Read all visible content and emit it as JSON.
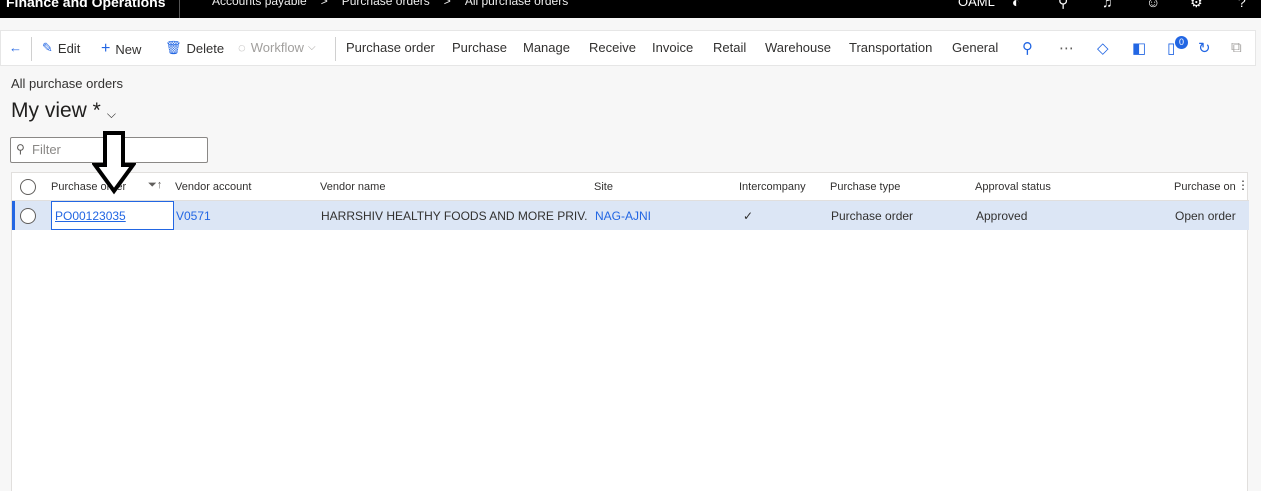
{
  "topbar": {
    "app_title": "Finance and Operations",
    "breadcrumb": [
      "Accounts payable",
      "Purchase orders",
      "All purchase orders"
    ],
    "breadcrumb_sep": ">",
    "company": "OAML"
  },
  "actionpane": {
    "edit": "Edit",
    "new": "New",
    "delete": "Delete",
    "workflow": "Workflow",
    "tabs": [
      "Purchase order",
      "Purchase",
      "Manage",
      "Receive",
      "Invoice",
      "Retail",
      "Warehouse",
      "Transportation",
      "General"
    ],
    "notification_count": "0"
  },
  "page": {
    "caption": "All purchase orders",
    "view_title": "My view *",
    "filter_placeholder": "Filter"
  },
  "grid": {
    "columns": [
      "Purchase order",
      "Vendor account",
      "Vendor name",
      "Site",
      "Intercompany",
      "Purchase type",
      "Approval status",
      "Purchase on"
    ],
    "rows": [
      {
        "purchase_order": "PO00123035",
        "vendor_account": "V0571",
        "vendor_name": "HARRSHIV HEALTHY FOODS AND MORE PRIV...",
        "site": "NAG-AJNI",
        "intercompany": "✓",
        "purchase_type": "Purchase order",
        "approval_status": "Approved",
        "purchase_on": "Open order"
      }
    ]
  },
  "annotation": {
    "arrow_color": "#000000"
  }
}
